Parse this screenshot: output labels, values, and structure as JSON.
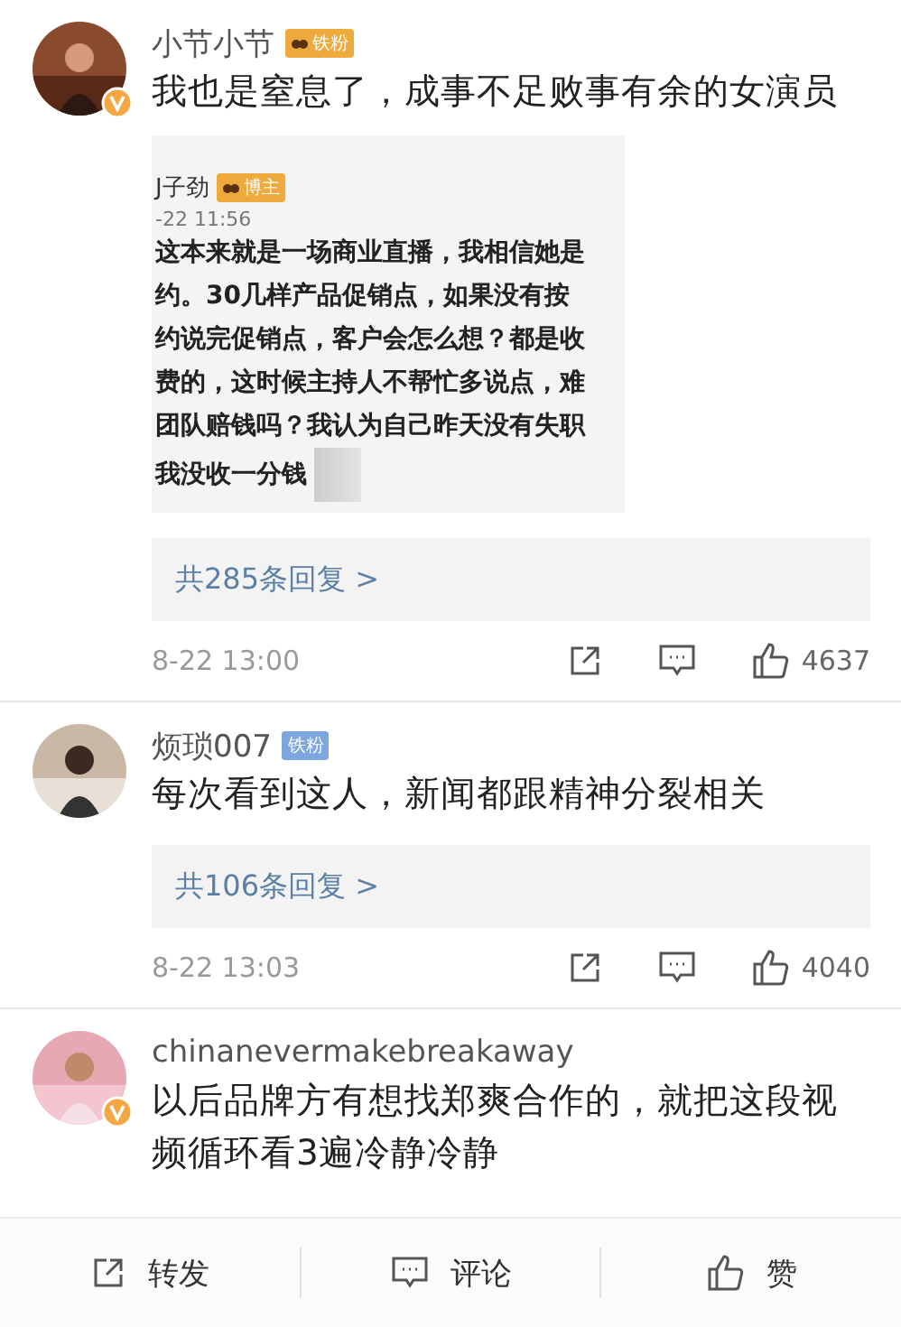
{
  "comments": [
    {
      "username": "小节小节",
      "verified": true,
      "badge": {
        "label": "铁粉",
        "color": "#eeaa3c",
        "emblem": true
      },
      "text": "我也是窒息了，成事不足败事有余的女演员",
      "quote": {
        "author": "J子劲",
        "badge": {
          "label": "博主",
          "color": "#eeaa3c",
          "emblem": true
        },
        "time": "-22 11:56",
        "lines": [
          "这本来就是一场商业直播，我相信她是",
          "约。30几样产品促销点，如果没有按",
          "约说完促销点，客户会怎么想？都是收",
          "费的，这时候主持人不帮忙多说点，难",
          "团队赔钱吗？我认为自己昨天没有失职",
          "我没收一分钱"
        ]
      },
      "replies": "共285条回复 >",
      "time": "8-22 13:00",
      "likes": "4637"
    },
    {
      "username": "烦琐007",
      "verified": false,
      "badge": {
        "label": "铁粉",
        "color": "#7ea6de",
        "emblem": false
      },
      "text": "每次看到这人，新闻都跟精神分裂相关",
      "replies": "共106条回复 >",
      "time": "8-22 13:03",
      "likes": "4040"
    },
    {
      "username": "chinanevermakebreakaway",
      "verified": true,
      "text": "以后品牌方有想找郑爽合作的，就把这段视频循环看3遍冷静冷静"
    }
  ],
  "toolbar": [
    {
      "kind": "repost",
      "label": "转发"
    },
    {
      "kind": "comment",
      "label": "评论"
    },
    {
      "kind": "like",
      "label": "赞"
    }
  ]
}
